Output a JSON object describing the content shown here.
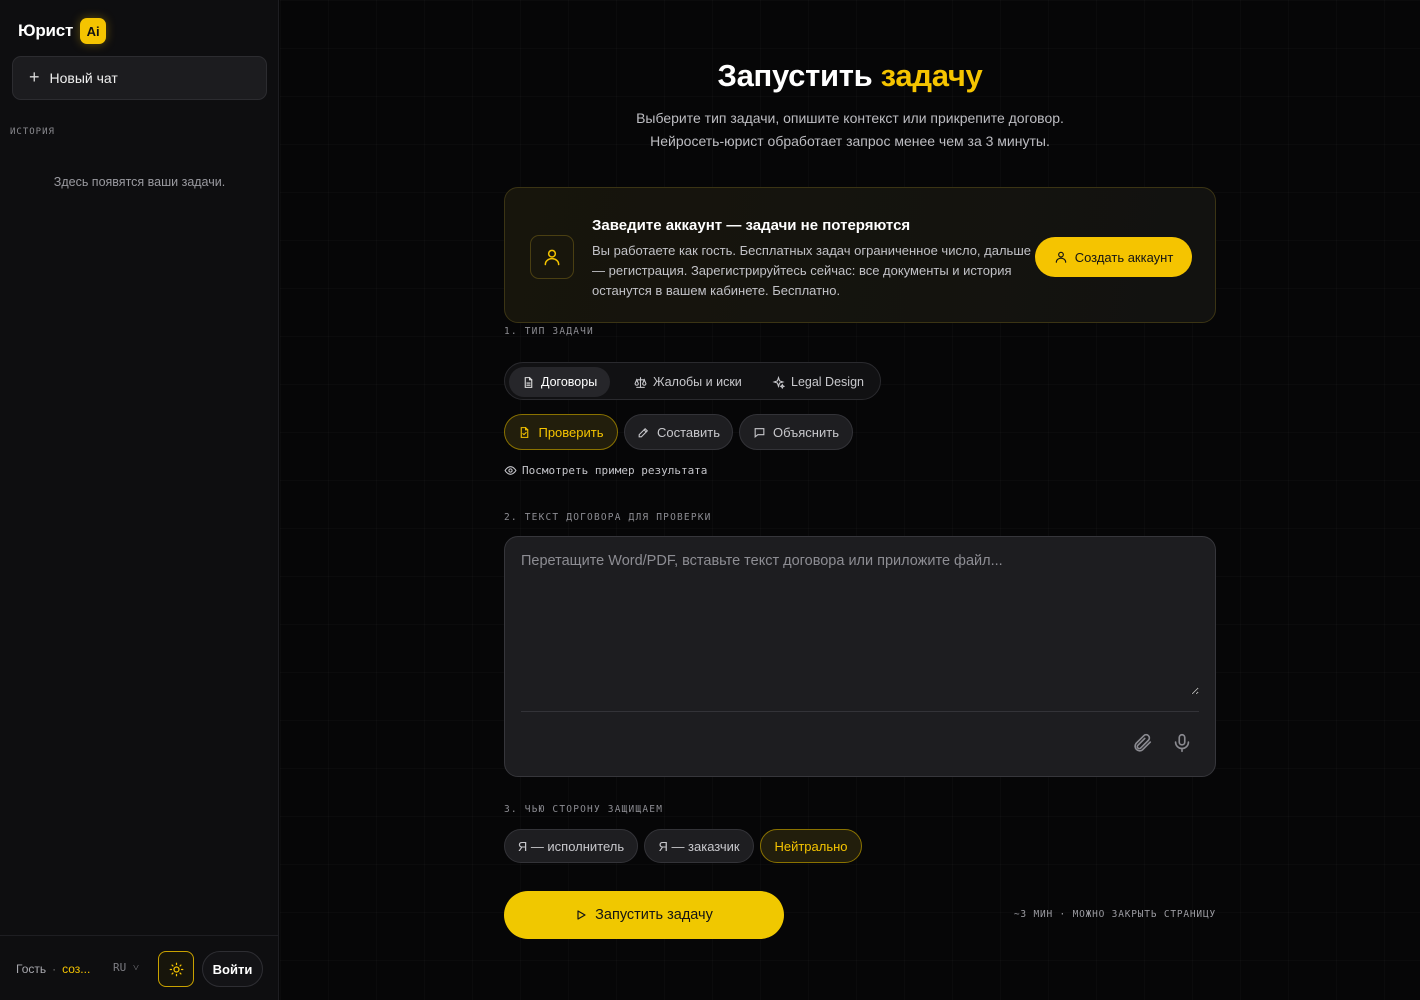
{
  "brand": {
    "name": "Юрист",
    "badge": "Ai"
  },
  "sidebar": {
    "new_chat_label": "Новый чат",
    "history_title": "ИСТОРИЯ",
    "history_empty": "Здесь появятся ваши задачи.",
    "footer": {
      "guest_label": "Гость",
      "separator": "·",
      "create_link": "соз...",
      "language": "RU ˅",
      "theme_icon": "sun-icon",
      "login_label": "Войти"
    }
  },
  "main": {
    "title_prefix": "Запустить ",
    "title_accent": "задачу",
    "subtitle_line1": "Выберите тип задачи, опишите контекст или прикрепите договор.",
    "subtitle_line2": "Нейросеть-юрист обработает запрос менее чем за 3 минуты.",
    "promo": {
      "title": "Заведите аккаунт — задачи не потеряются",
      "text": "Вы работаете как гость. Бесплатных задач ограниченное число, дальше — регистрация. Зарегистрируйтесь сейчас: все документы и история останутся в вашем кабинете. Бесплатно.",
      "button": "Создать аккаунт"
    },
    "step1_label": "1. ТИП ЗАДАЧИ",
    "task_tabs": [
      {
        "label": "Договоры",
        "icon": "document-icon",
        "active": true
      },
      {
        "label": "Жалобы и иски",
        "icon": "scales-icon",
        "active": false
      },
      {
        "label": "Legal Design",
        "icon": "sparkle-icon",
        "active": false
      }
    ],
    "modes": [
      {
        "label": "Проверить",
        "icon": "file-check-icon",
        "active": true
      },
      {
        "label": "Составить",
        "icon": "pencil-icon",
        "active": false
      },
      {
        "label": "Объяснить",
        "icon": "chat-icon",
        "active": false
      }
    ],
    "example_link": "Посмотреть пример результата",
    "step2_label": "2. ТЕКСТ ДОГОВОРА ДЛЯ ПРОВЕРКИ",
    "editor_placeholder": "Перетащите Word/PDF, вставьте текст договора или приложите файл...",
    "editor_value": "",
    "step3_label": "3. ЧЬЮ СТОРОНУ ЗАЩИЩАЕМ",
    "sides": [
      {
        "label": "Я — исполнитель",
        "active": false
      },
      {
        "label": "Я — заказчик",
        "active": false
      },
      {
        "label": "Нейтрально",
        "active": true
      }
    ],
    "run_button": "Запустить задачу",
    "run_note": "~3 МИН · МОЖНО ЗАКРЫТЬ СТРАНИЦУ"
  },
  "colors": {
    "accent": "#f5c400",
    "background": "#060607",
    "sidebar": "#0e0e10"
  }
}
